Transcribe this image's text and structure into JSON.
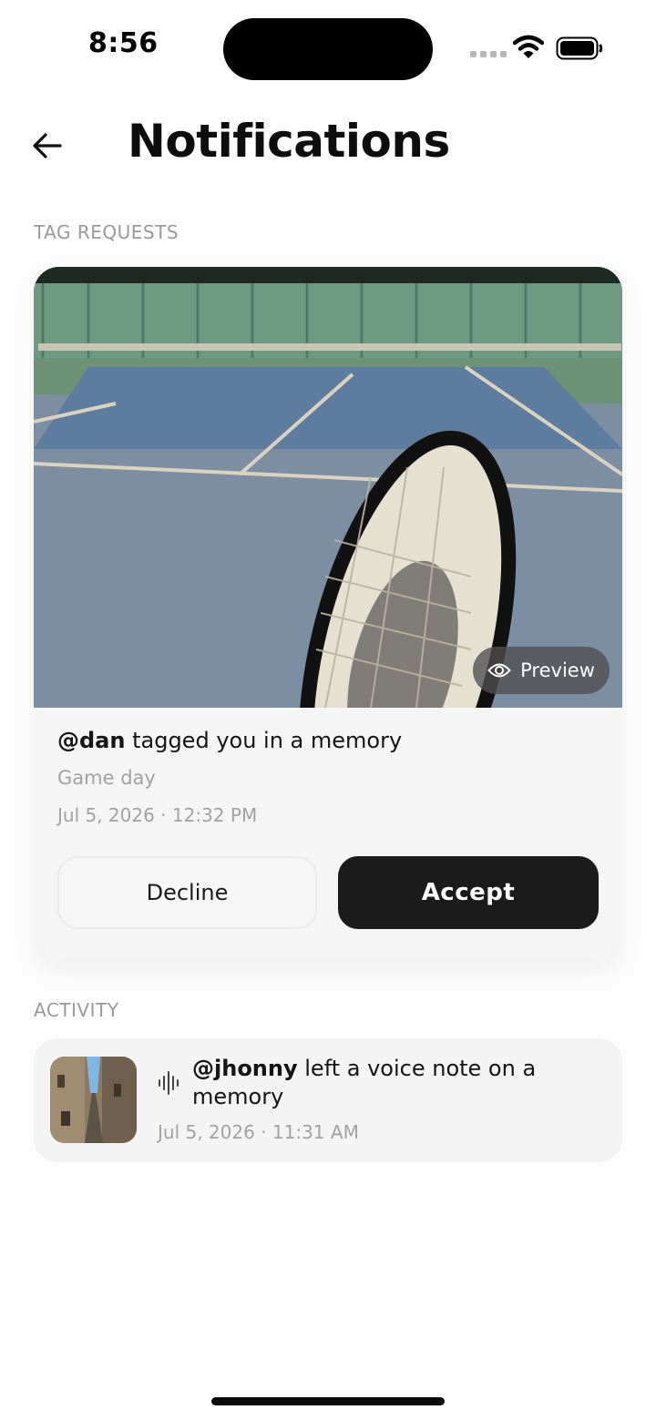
{
  "status_bar": {
    "time": "8:56"
  },
  "header": {
    "title": "Notifications",
    "back_icon": "arrow-left-icon"
  },
  "tag_requests": {
    "section_label": "TAG REQUESTS",
    "item": {
      "username": "@dan",
      "message": " tagged you in a memory",
      "caption": "Game day",
      "timestamp": "Jul 5, 2026 · 12:32 PM",
      "preview_label": "Preview",
      "decline_label": "Decline",
      "accept_label": "Accept"
    }
  },
  "activity": {
    "section_label": "ACTIVITY",
    "items": [
      {
        "username": "@jhonny",
        "message": " left a voice note on a memory",
        "timestamp": "Jul 5, 2026 · 11:31 AM",
        "icon": "voice-waveform-icon"
      }
    ]
  },
  "colors": {
    "accent_dark": "#1b1b1b",
    "muted_text": "#a2a2a2",
    "card_bg": "#f5f5f5"
  }
}
